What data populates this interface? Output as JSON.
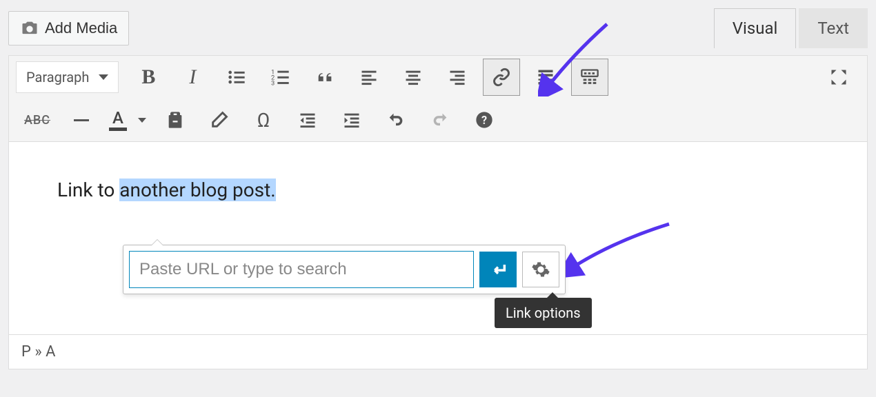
{
  "add_media_label": "Add Media",
  "tabs": {
    "visual": "Visual",
    "text": "Text"
  },
  "format_select": "Paragraph",
  "toolbar": {
    "row1": {
      "bold": "B",
      "italic": "I"
    },
    "row2": {
      "special_char": "Ω",
      "strike": "ABC"
    }
  },
  "content": {
    "prefix": "Link to ",
    "selected": "another blog post.",
    "suffix": ""
  },
  "link_popover": {
    "placeholder": "Paste URL or type to search",
    "tooltip": "Link options"
  },
  "status_bar": "P » A"
}
